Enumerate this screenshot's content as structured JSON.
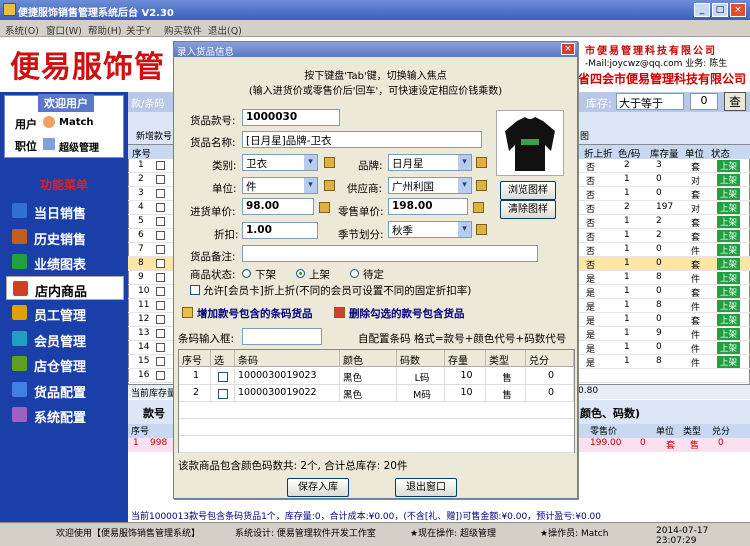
{
  "window": {
    "title": "便捷服饰销售管理系统后台 V2.30",
    "min": "_",
    "max": "□",
    "close": "×"
  },
  "menu": [
    "系统(O)",
    "窗口(W)",
    "帮助(H)",
    "关于Y",
    "购买软件",
    "退出(Q)"
  ],
  "banner": {
    "brand": "便易服饰管",
    "company": "市便易管理科技有限公司",
    "contact": "-Mail:joycwz@qq.com 业务: 陈生",
    "company2": "省四会市便易管理科技有限公司"
  },
  "user": {
    "welcome": "欢迎用户",
    "user_label": "用户",
    "user_value": "Match",
    "role_label": "职位",
    "role_value": "超级管理"
  },
  "func_title": "功能菜单",
  "nav": [
    {
      "label": "当日销售",
      "color": "#3070d0"
    },
    {
      "label": "历史销售",
      "color": "#c06020"
    },
    {
      "label": "业绩图表",
      "color": "#20a040"
    },
    {
      "label": "店内商品",
      "color": "#d04020"
    },
    {
      "label": "员工管理",
      "color": "#e0a000"
    },
    {
      "label": "会员管理",
      "color": "#20a0c0"
    },
    {
      "label": "店仓管理",
      "color": "#60a020"
    },
    {
      "label": "货品配置",
      "color": "#4080e0"
    },
    {
      "label": "系统配置",
      "color": "#a060c0"
    }
  ],
  "main": {
    "search_prefix": "款/条码",
    "stock_label": "库存:",
    "stock_op": "大于等于",
    "stock_value": "0",
    "search_btn": "查",
    "new_btn": "新增款号",
    "tab_label": "图",
    "grid_headers": [
      "折上折",
      "色/码",
      "库存量",
      "单位",
      "状态"
    ],
    "grid_rows": [
      [
        "否",
        "2",
        "3",
        "套",
        "上架"
      ],
      [
        "否",
        "1",
        "0",
        "对",
        "上架"
      ],
      [
        "否",
        "1",
        "0",
        "套",
        "上架"
      ],
      [
        "否",
        "2",
        "197",
        "对",
        "上架"
      ],
      [
        "否",
        "1",
        "2",
        "套",
        "上架"
      ],
      [
        "否",
        "1",
        "2",
        "套",
        "上架"
      ],
      [
        "否",
        "1",
        "0",
        "件",
        "上架"
      ],
      [
        "否",
        "1",
        "0",
        "套",
        "上架"
      ],
      [
        "是",
        "1",
        "8",
        "件",
        "上架"
      ],
      [
        "是",
        "1",
        "0",
        "套",
        "上架"
      ],
      [
        "是",
        "1",
        "8",
        "件",
        "上架"
      ],
      [
        "是",
        "1",
        "0",
        "套",
        "上架"
      ],
      [
        "是",
        "1",
        "9",
        "件",
        "上架"
      ],
      [
        "是",
        "1",
        "0",
        "件",
        "上架"
      ],
      [
        "是",
        "1",
        "8",
        "件",
        "上架"
      ]
    ],
    "left_col_header": "序号",
    "left_nums": [
      "1",
      "2",
      "3",
      "4",
      "5",
      "6",
      "7",
      "8",
      "9",
      "10",
      "11",
      "12",
      "13",
      "14",
      "15",
      "16"
    ],
    "sum_prefix": "当前库存量",
    "sum_right": "0.80",
    "lower_label": "款号",
    "lower_right": "颜色、码数)",
    "lower_headers": [
      "序号",
      "零售价",
      "单位",
      "类型",
      "兑分"
    ],
    "lower_row": [
      "1",
      "998",
      "199.00",
      "0",
      "套",
      "售",
      "0"
    ],
    "bottom_info": "当前1000013款号包含条码货品1个，库存量:0，合计成本:¥0.00，(不含[礼、赠])可售金额:¥0.00，预计盈亏:¥0.00"
  },
  "status": {
    "left": "欢迎使用【便易服饰销售管理系统】",
    "design": "系统设计: 便易管理软件开发工作室",
    "current": "★现在操作: 超级管理",
    "operator": "★操作员: Match",
    "time": "2014-07-17 23:07:29"
  },
  "dialog": {
    "title": "录入货品信息",
    "close": "×",
    "hint1": "按下键盘'Tab'键，切换输入焦点",
    "hint2": "(输入进货价或零售价后'回车'，可快速设定相应价钱乘数)",
    "code_label": "货品款号:",
    "code_value": "1000030",
    "name_label": "货品名称:",
    "name_value": "[日月星]品牌-卫衣",
    "type_label": "类别:",
    "type_value": "卫衣",
    "brand_label": "品牌:",
    "brand_value": "日月星",
    "unit_label": "单位:",
    "unit_value": "件",
    "supplier_label": "供应商:",
    "supplier_value": "广州利国",
    "cost_label": "进货单价:",
    "cost_value": "98.00",
    "retail_label": "零售单价:",
    "retail_value": "198.00",
    "discount_label": "折扣:",
    "discount_value": "1.00",
    "season_label": "季节划分:",
    "season_value": "秋季",
    "remark_label": "货品备注:",
    "remark_value": "",
    "browse_btn": "浏览图样",
    "clear_btn": "清除图样",
    "status_label": "商品状态:",
    "status_opts": [
      "下架",
      "上架",
      "待定"
    ],
    "allow_text": "允许[会员卡]折上折(不同的会员可设置不同的固定折扣率)",
    "add_link": "增加款号包含的条码货品",
    "del_link": "删除勾选的款号包含货品",
    "barcode_label": "条码输入框:",
    "barcode_value": "",
    "auto_text": "自配置条码 格式=款号+颜色代号+码数代号",
    "table_headers": [
      "序号",
      "选",
      "条码",
      "颜色",
      "码数",
      "存量",
      "类型",
      "兑分"
    ],
    "table_rows": [
      [
        "1",
        "",
        "1000030019023",
        "黑色",
        "L码",
        "10",
        "售",
        "0"
      ],
      [
        "2",
        "",
        "1000030019022",
        "黑色",
        "M码",
        "10",
        "售",
        "0"
      ]
    ],
    "summary": "该款商品包含颜色码数共: 2个, 合计总库存: 20件",
    "save_btn": "保存入库",
    "exit_btn": "退出窗口"
  }
}
